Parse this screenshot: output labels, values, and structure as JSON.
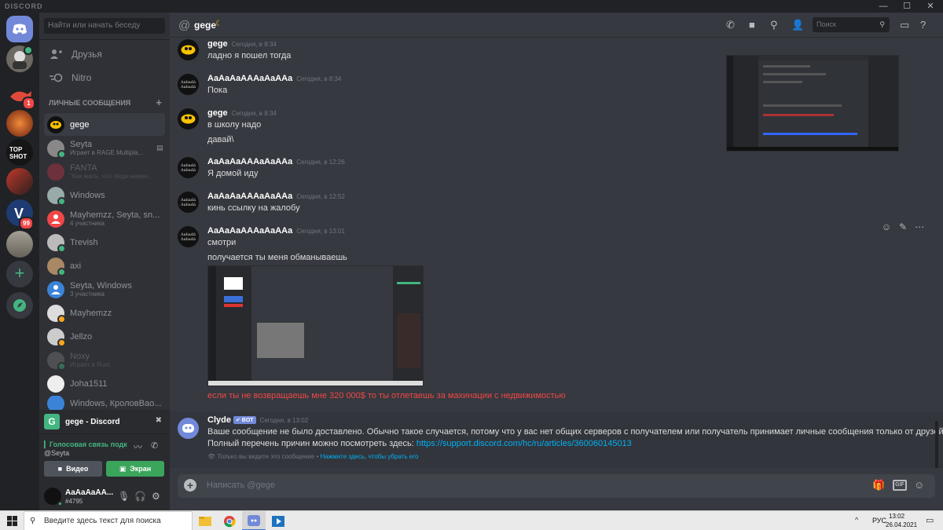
{
  "window": {
    "brand": "DISCORD",
    "min": "—",
    "max": "☐",
    "close": "✕"
  },
  "servers": {
    "badges": [
      "1",
      "99"
    ]
  },
  "sidebar": {
    "search_placeholder": "Найти или начать беседу",
    "nav": [
      {
        "label": "Друзья"
      },
      {
        "label": "Nitro"
      }
    ],
    "dm_header": "ЛИЧНЫЕ СООБЩЕНИЯ",
    "dm_add": "+",
    "dms": [
      {
        "name": "gege",
        "sub": ""
      },
      {
        "name": "Seyta",
        "sub": "Играет в RAGE Multipla..."
      },
      {
        "name": "FANTA",
        "sub": "\"Как жаль, что люди начин..."
      },
      {
        "name": "Windows",
        "sub": ""
      },
      {
        "name": "Mayhemzz, Seyta, sn...",
        "sub": "4 участника"
      },
      {
        "name": "Trevish",
        "sub": ""
      },
      {
        "name": "axi",
        "sub": ""
      },
      {
        "name": "Seyta, Windows",
        "sub": "3 участника"
      },
      {
        "name": "Mayhemzz",
        "sub": ""
      },
      {
        "name": "Jellzo",
        "sub": ""
      },
      {
        "name": "Noxy",
        "sub": "Играет в Rust"
      },
      {
        "name": "Joha1511",
        "sub": ""
      },
      {
        "name": "Windows, КроловВао...",
        "sub": ""
      }
    ]
  },
  "voice_app": {
    "icon": "G",
    "title": "gege - Discord"
  },
  "voice": {
    "status": "Голосовая связь подк",
    "channel": "@Seyta",
    "video_label": "Видео",
    "screen_label": "Экран"
  },
  "user": {
    "name": "AaAaAaAA...",
    "tag": "#4795"
  },
  "chat": {
    "at": "@",
    "title": "gege",
    "search_placeholder": "Поиск",
    "messages": [
      {
        "author": "gege",
        "time": "Сегодня, в 8:34",
        "lines": [
          "ладно я пошел тогда"
        ]
      },
      {
        "author": "AaAaAaAAAaAaAAa",
        "time": "Сегодня, в 8:34",
        "lines": [
          "Пока"
        ]
      },
      {
        "author": "gege",
        "time": "Сегодня, в 8:34",
        "lines": [
          "в школу надо",
          "давай\\"
        ]
      },
      {
        "author": "AaAaAaAAAaAaAAa",
        "time": "Сегодня, в 12:26",
        "lines": [
          "Я домой иду"
        ]
      },
      {
        "author": "AaAaAaAAAaAaAAa",
        "time": "Сегодня, в 12:52",
        "lines": [
          "кинь ссылку на жалобу"
        ]
      },
      {
        "author": "AaAaAaAAAaAaAAa",
        "time": "Сегодня, в 13:01",
        "lines": [
          "смотри",
          "получается ты меня обманываешь"
        ]
      }
    ],
    "red_line": "если ты не возвращаешь мне 320 000$ то ты отлетаешь за махинации с недвижимостью",
    "clyde": {
      "author": "Clyde",
      "bot_tag": "✔ BOT",
      "time": "Сегодня, в 13:02",
      "line1": "Ваше сообщение не было доставлено. Обычно такое случается, потому что у вас нет общих серверов с получателем или получатель принимает личные сообщения только от друзей.",
      "line2_prefix": "Полный перечень причин можно посмотреть здесь: ",
      "link": "https://support.discord.com/hc/ru/articles/360060145013",
      "note": "Только вы видите это сообщение • ",
      "dismiss": "Нажмите здесь, чтобы убрать его"
    },
    "composer_placeholder": "Написать @gege",
    "composer_gif": "GIF"
  },
  "taskbar": {
    "search_placeholder": "Введите здесь текст для поиска",
    "lang": "РУС",
    "time": "13:02",
    "date": "26.04.2021"
  },
  "colors": {
    "blurple": "#7289da",
    "green": "#43b581",
    "red": "#f04747",
    "link": "#00b0f4",
    "bg": "#36393f"
  }
}
